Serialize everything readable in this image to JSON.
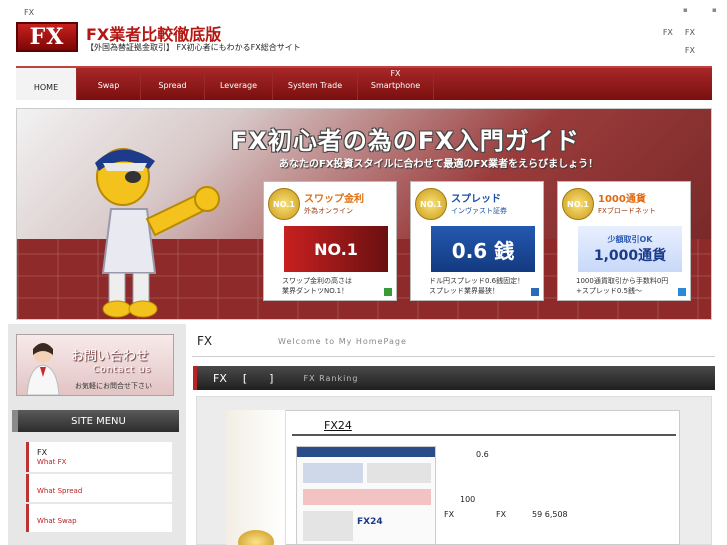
{
  "topbar": {
    "small_label": "FX"
  },
  "header": {
    "logo_text": "FX",
    "title": "FX業者比較徹底版",
    "subtitle": "【外国為替証拠金取引】 FX初心者にもわかるFX総合サイト",
    "links": [
      "FX",
      "FX",
      "FX"
    ]
  },
  "nav": {
    "items": [
      {
        "label": "HOME"
      },
      {
        "label": "Swap"
      },
      {
        "label": "Spread"
      },
      {
        "label": "Leverage"
      },
      {
        "label": "System Trade"
      },
      {
        "label_top": "FX",
        "label": "Smartphone"
      }
    ]
  },
  "banner": {
    "title": "FX初心者の為のFX入門ガイド",
    "subtitle": "あなたのFX投資スタイルに合わせて最適のFX業者をえらびましょう！",
    "cards": [
      {
        "badge": "NO.1",
        "heading": "スワップ金利",
        "sub": "外為オンライン",
        "text_line1": "スワップ金利の高さは",
        "text_line2": "業界ダントツNO.1！",
        "accent": "#3a9a3a"
      },
      {
        "badge": "NO.1",
        "heading": "スプレッド",
        "sub": "インヴァスト証券",
        "value": "0.6 銭",
        "text_line1": "ドル円スプレッド0.6銭固定！",
        "text_line2": "スプレッド業界最狭！",
        "accent": "#2a6ab8"
      },
      {
        "badge": "NO.1",
        "heading": "1000通貨",
        "sub": "FXブロードネット",
        "value": "1,000通貨",
        "text_line1": "1000通貨取引から手数料0円",
        "text_line2": "+スプレッド0.5銭～",
        "accent": "#2a8ad8"
      }
    ],
    "card1_img_text": "NO.1",
    "card3_img_top": "少額取引OK"
  },
  "sidebar": {
    "contact_title": "お問い合わせ",
    "contact_en": "Contact us",
    "contact_note": "お気軽にお問合せ下さい",
    "menu_title": "SITE MENU",
    "menu": [
      {
        "title": "FX",
        "sub": "What FX"
      },
      {
        "title": "",
        "sub": "What Spread"
      },
      {
        "title": "",
        "sub": "What Swap"
      }
    ]
  },
  "main": {
    "title": "FX",
    "welcome": "Welcome to My HomePage",
    "ranking_fx": "FX",
    "ranking_bracket": "[　　]",
    "ranking_en": "FX Ranking",
    "first": {
      "name": "FX24",
      "spread": "0.6",
      "units": "100",
      "label_a": "FX",
      "label_b": "FX",
      "count": "59 6,508",
      "thumb_logo": "FX24"
    }
  }
}
